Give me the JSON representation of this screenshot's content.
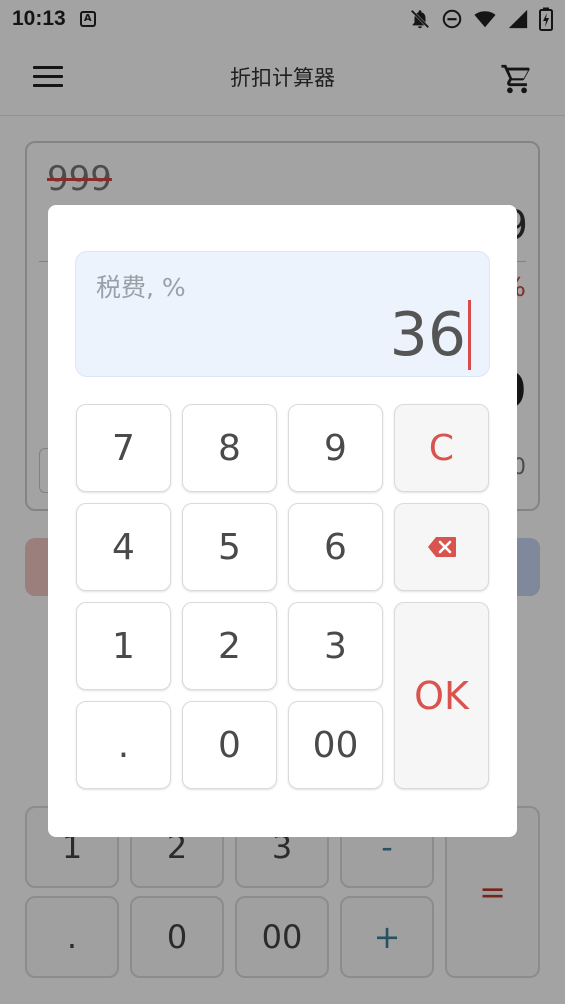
{
  "status": {
    "time": "10:13",
    "a_icon": "A"
  },
  "appbar": {
    "title": "折扣计算器"
  },
  "background": {
    "original_price": "999",
    "partial_nine": "9",
    "percent_sign": "%",
    "big_zero": "0",
    "small_zero": "0",
    "keys": [
      "1",
      "2",
      "3",
      "-",
      ".",
      "0",
      "00",
      "+"
    ],
    "equals": "="
  },
  "dialog": {
    "label": "税费, %",
    "value": "36",
    "keys": {
      "k7": "7",
      "k8": "8",
      "k9": "9",
      "clear": "C",
      "k4": "4",
      "k5": "5",
      "k6": "6",
      "k1": "1",
      "k2": "2",
      "k3": "3",
      "dot": ".",
      "k0": "0",
      "k00": "00",
      "ok": "OK"
    }
  },
  "colors": {
    "accent_red": "#d9534f",
    "display_bg": "#edf3fd"
  }
}
